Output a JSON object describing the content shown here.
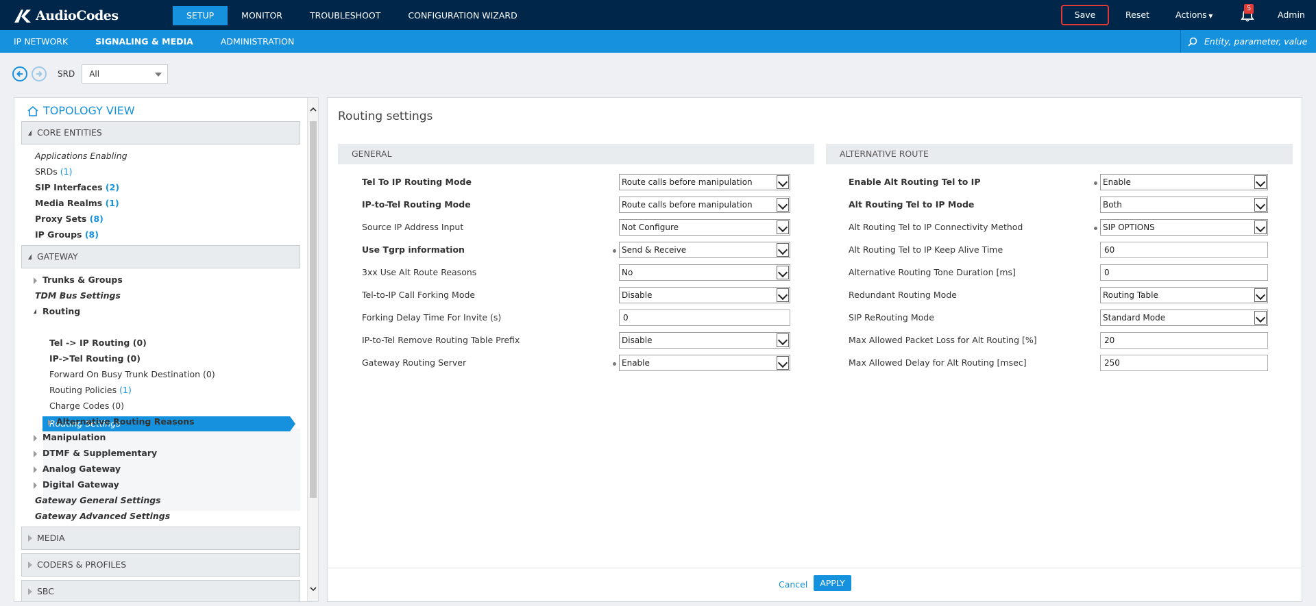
{
  "brand": {
    "name": "AudioCodes"
  },
  "topnav": [
    {
      "label": "SETUP",
      "active": true
    },
    {
      "label": "MONITOR",
      "active": false
    },
    {
      "label": "TROUBLESHOOT",
      "active": false
    },
    {
      "label": "CONFIGURATION WIZARD",
      "active": false
    }
  ],
  "toolbar": {
    "save_label": "Save",
    "reset_label": "Reset",
    "actions_label": "Actions",
    "notification_count": "5",
    "admin_label": "Admin"
  },
  "subnav": [
    {
      "label": "IP NETWORK",
      "active": false
    },
    {
      "label": "SIGNALING & MEDIA",
      "active": true
    },
    {
      "label": "ADMINISTRATION",
      "active": false
    }
  ],
  "search": {
    "placeholder": "Entity, parameter, value"
  },
  "srd": {
    "label": "SRD",
    "value": "All"
  },
  "topology": {
    "title": "TOPOLOGY VIEW",
    "sections": {
      "core": "CORE ENTITIES",
      "gateway": "GATEWAY",
      "media": "MEDIA",
      "coders": "CODERS & PROFILES",
      "sbc": "SBC"
    },
    "core_items": [
      {
        "label": "Applications Enabling",
        "count": ""
      },
      {
        "label": "SRDs",
        "count": "(1)"
      },
      {
        "label": "SIP Interfaces",
        "count": "(2)"
      },
      {
        "label": "Media Realms",
        "count": "(1)"
      },
      {
        "label": "Proxy Sets",
        "count": "(8)"
      },
      {
        "label": "IP Groups",
        "count": "(8)"
      }
    ],
    "gateway_items": {
      "trunks": "Trunks & Groups",
      "tdm": "TDM Bus Settings",
      "routing": "Routing",
      "routing_settings": "Routing Settings",
      "tel_ip": "Tel -> IP Routing (0)",
      "ip_tel": "IP->Tel Routing (0)",
      "forward_busy": "Forward On Busy Trunk Destination (0)",
      "routing_policies": "Routing Policies",
      "routing_policies_count": "(1)",
      "charge_codes": "Charge Codes (0)",
      "alt_reasons": "Alternative Routing Reasons",
      "manipulation": "Manipulation",
      "dtmf": "DTMF & Supplementary",
      "analog": "Analog Gateway",
      "digital": "Digital Gateway",
      "gw_general": "Gateway General Settings",
      "gw_advanced": "Gateway Advanced Settings"
    }
  },
  "main": {
    "title": "Routing settings",
    "general": {
      "heading": "GENERAL",
      "rows": [
        {
          "label": "Tel To IP Routing Mode",
          "value": "Route calls before manipulation"
        },
        {
          "label": "IP-to-Tel Routing Mode",
          "value": "Route calls before manipulation"
        },
        {
          "label": "Source IP Address Input",
          "value": "Not Configure"
        },
        {
          "label": "Use Tgrp information",
          "value": "Send & Receive"
        },
        {
          "label": "3xx Use Alt Route Reasons",
          "value": "No"
        },
        {
          "label": "Tel-to-IP Call Forking Mode",
          "value": "Disable"
        },
        {
          "label": "Forking Delay Time For Invite (s)",
          "value": "0"
        },
        {
          "label": "IP-to-Tel Remove Routing Table Prefix",
          "value": "Disable"
        },
        {
          "label": "Gateway Routing Server",
          "value": "Enable"
        }
      ]
    },
    "alternative": {
      "heading": "ALTERNATIVE ROUTE",
      "rows": [
        {
          "label": "Enable Alt Routing Tel to IP",
          "value": "Enable"
        },
        {
          "label": "Alt Routing Tel to IP Mode",
          "value": "Both"
        },
        {
          "label": "Alt Routing Tel to IP Connectivity Method",
          "value": "SIP OPTIONS"
        },
        {
          "label": "Alt Routing Tel to IP Keep Alive Time",
          "value": "60"
        },
        {
          "label": "Alternative Routing Tone Duration [ms]",
          "value": "0"
        },
        {
          "label": "Redundant Routing Mode",
          "value": "Routing Table"
        },
        {
          "label": "SIP ReRouting Mode",
          "value": "Standard Mode"
        },
        {
          "label": "Max Allowed Packet Loss for Alt Routing [%]",
          "value": "20"
        },
        {
          "label": "Max Allowed Delay for Alt Routing [msec]",
          "value": "250"
        }
      ]
    },
    "cancel_label": "Cancel",
    "apply_label": "APPLY"
  },
  "colors": {
    "topbar": "#00264a",
    "accent": "#1591de",
    "save_outline": "#e53935"
  }
}
